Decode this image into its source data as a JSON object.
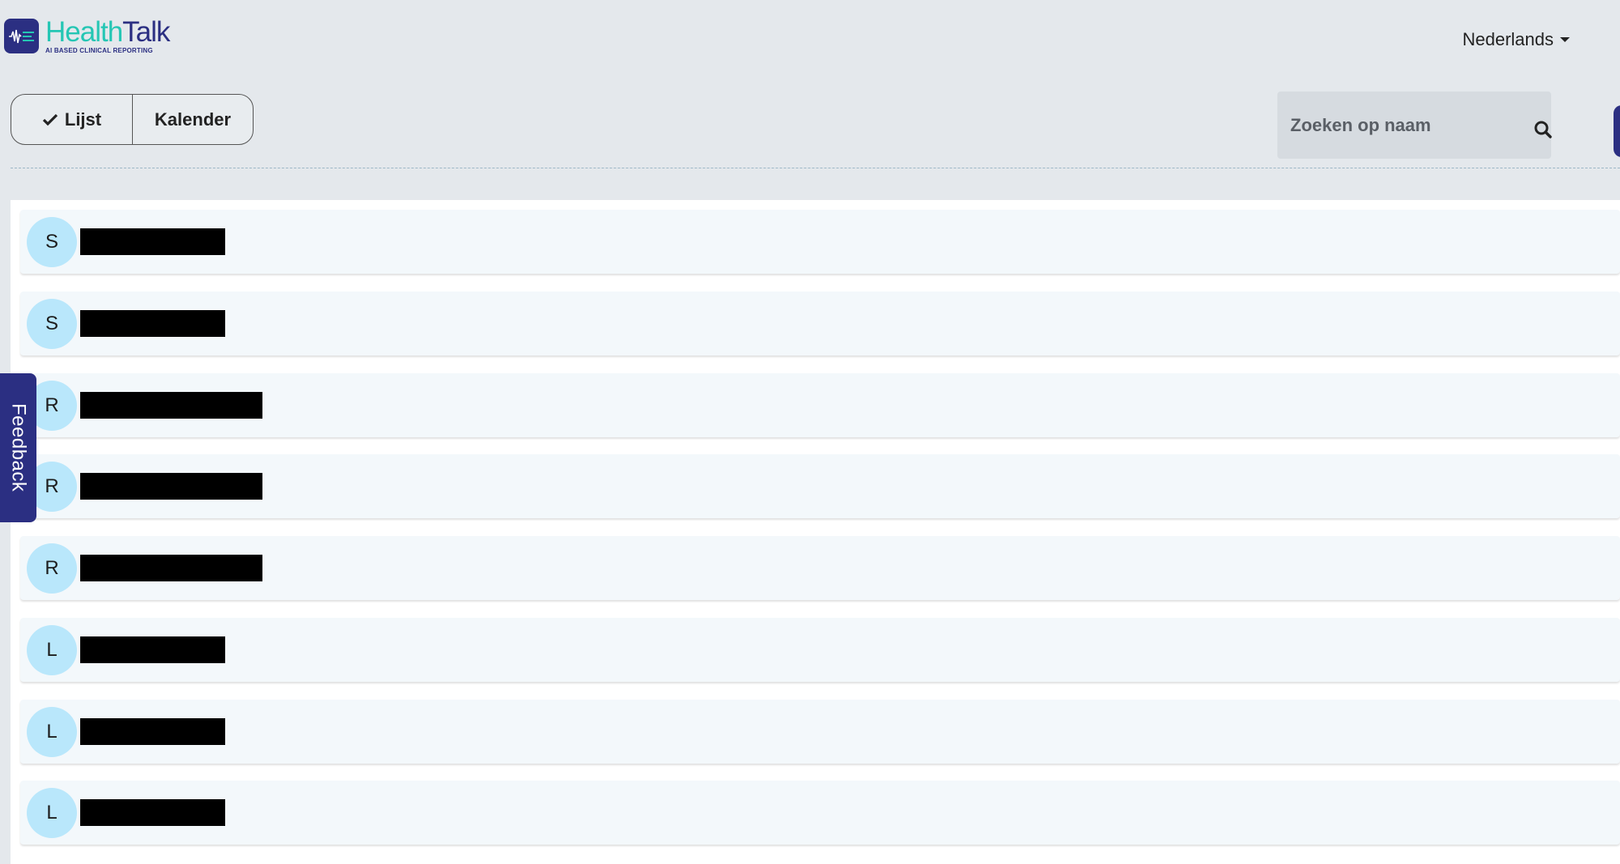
{
  "header": {
    "logo_title_part1": "Health",
    "logo_title_part2": "Talk",
    "logo_subtitle": "AI BASED CLINICAL REPORTING",
    "language": "Nederlands"
  },
  "view_toggle": {
    "list_label": "Lijst",
    "calendar_label": "Kalender",
    "selected": "Lijst"
  },
  "search": {
    "placeholder": "Zoeken op naam",
    "value": ""
  },
  "feedback_label": "Feedback",
  "patients": [
    {
      "initial": "S",
      "name_redacted": true
    },
    {
      "initial": "S",
      "name_redacted": true
    },
    {
      "initial": "R",
      "name_redacted": true
    },
    {
      "initial": "R",
      "name_redacted": true
    },
    {
      "initial": "R",
      "name_redacted": true
    },
    {
      "initial": "L",
      "name_redacted": true
    },
    {
      "initial": "L",
      "name_redacted": true
    },
    {
      "initial": "L",
      "name_redacted": true
    }
  ],
  "colors": {
    "brand_navy": "#2b2f82",
    "brand_teal": "#25c6b4",
    "avatar_bg": "#b9e7fb",
    "page_bg": "#e4e8ec"
  }
}
